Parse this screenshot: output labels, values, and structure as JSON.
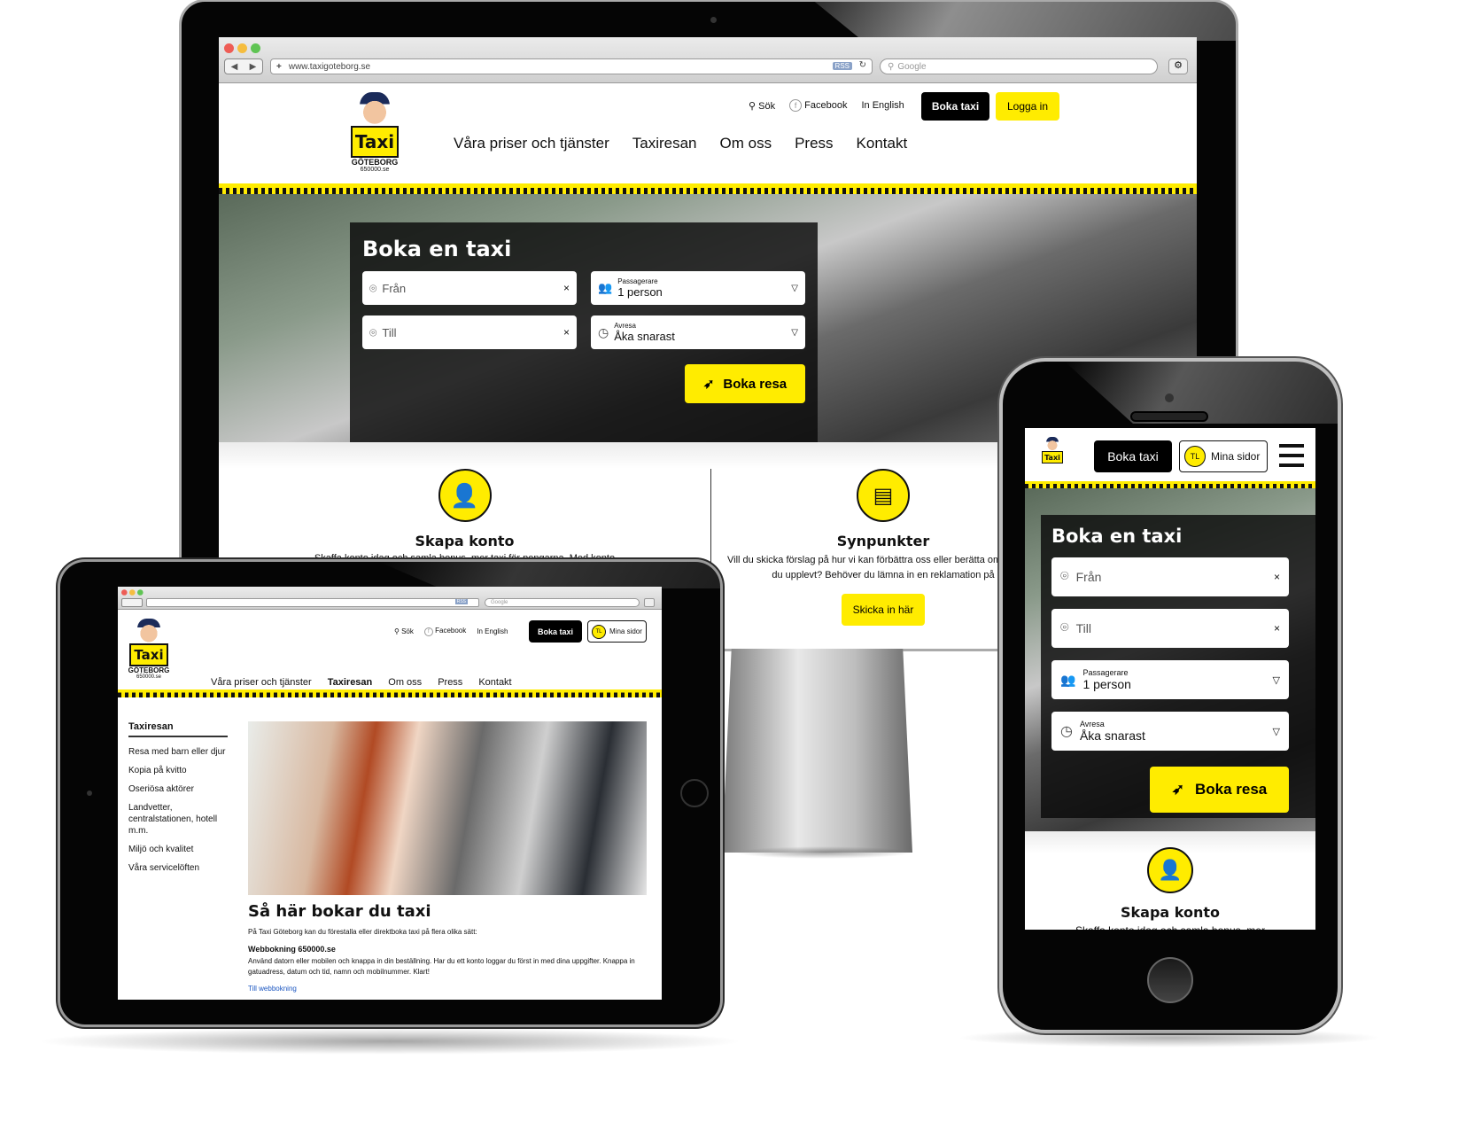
{
  "desktop": {
    "browser": {
      "url": "www.taxigoteborg.se",
      "rss_label": "RSS",
      "search_placeholder": "Google"
    },
    "header": {
      "logo_city": "GÖTEBORG",
      "logo_phone": "650000.se",
      "logo_sign": "Taxi",
      "utility_links": [
        {
          "label": "Sök",
          "icon": "search-icon"
        },
        {
          "label": "Facebook",
          "icon": "facebook-icon"
        },
        {
          "label": "In English"
        }
      ],
      "boka_taxi": "Boka taxi",
      "logga_in": "Logga in",
      "nav": [
        "Våra priser och tjänster",
        "Taxiresan",
        "Om oss",
        "Press",
        "Kontakt"
      ]
    },
    "booking": {
      "title": "Boka en taxi",
      "from_placeholder": "Från",
      "to_placeholder": "Till",
      "clear_glyph": "×",
      "passengers_label": "Passagerare",
      "passengers_value": "1 person",
      "departure_label": "Avresa",
      "departure_value": "Åka snarast",
      "submit": "Boka resa"
    },
    "cards": [
      {
        "title": "Skapa konto",
        "text": "Skaffa konto idag och samla bonus, mer taxi för pengarna. Med konto",
        "icon": "user-icon"
      },
      {
        "title": "Synpunkter",
        "text": "Vill du skicka förslag på hur vi kan förbättra oss eller berätta om problem du upplevt? Behöver du lämna in en reklamation på",
        "icon": "chat-icon",
        "button": "Skicka in här"
      }
    ]
  },
  "tablet": {
    "browser": {
      "rss_label": "RSS",
      "search_placeholder": "Google"
    },
    "header": {
      "logo_city": "GÖTEBORG",
      "logo_phone": "650000.se",
      "logo_sign": "Taxi",
      "utility_links": [
        {
          "label": "Sök",
          "icon": "search-icon"
        },
        {
          "label": "Facebook",
          "icon": "facebook-icon"
        },
        {
          "label": "In English"
        }
      ],
      "boka_taxi": "Boka taxi",
      "avatar_initials": "TL",
      "mina_sidor": "Mina sidor",
      "nav": [
        "Våra priser och tjänster",
        "Taxiresan",
        "Om oss",
        "Press",
        "Kontakt"
      ],
      "active_nav": "Taxiresan"
    },
    "sidebar": {
      "title": "Taxiresan",
      "items": [
        "Resa med barn eller djur",
        "Kopia på kvitto",
        "Oseriösa aktörer",
        "Landvetter, centralstationen, hotell m.m.",
        "Miljö och kvalitet",
        "Våra servicelöften"
      ]
    },
    "article": {
      "title": "Så här bokar du taxi",
      "intro": "På Taxi Göteborg kan du förestalla eller direktboka taxi på flera olika sätt:",
      "subheading": "Webbokning 650000.se",
      "body": "Använd datorn eller mobilen och knappa in din beställning. Har du ett konto loggar du först in med dina uppgifter. Knappa in gatuadress, datum och tid, namn och mobilnummer. Klart!",
      "link": "Till webbokning"
    }
  },
  "phone": {
    "header": {
      "boka_taxi": "Boka taxi",
      "avatar_initials": "TL",
      "mina_sidor": "Mina sidor"
    },
    "booking": {
      "title": "Boka en taxi",
      "from_placeholder": "Från",
      "to_placeholder": "Till",
      "clear_glyph": "×",
      "passengers_label": "Passagerare",
      "passengers_value": "1 person",
      "departure_label": "Avresa",
      "departure_value": "Åka snarast",
      "submit": "Boka resa"
    },
    "card": {
      "title": "Skapa konto",
      "text": "Skaffa konto idag och samla bonus, mer"
    }
  },
  "colors": {
    "brand_yellow": "#ffec00",
    "brand_black": "#000000"
  }
}
